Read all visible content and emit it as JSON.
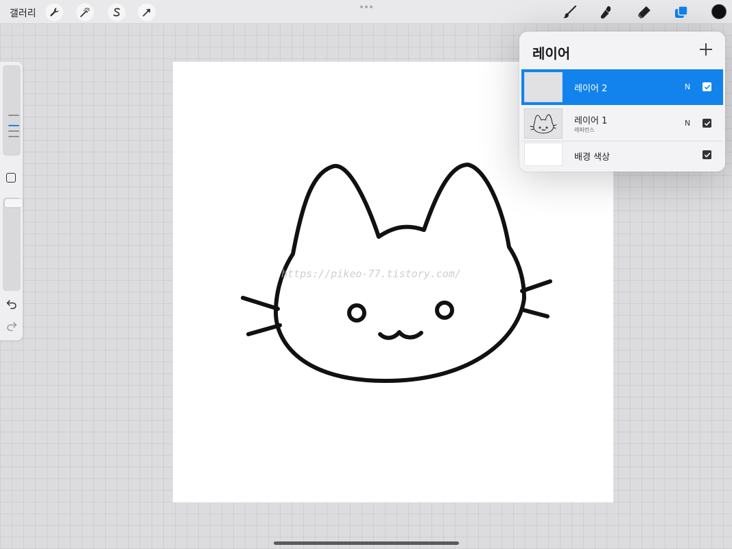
{
  "toolbar": {
    "gallery_label": "갤러리",
    "left_tools": [
      "wrench-icon",
      "magic-wand-icon",
      "selection-s-icon",
      "transform-arrow-icon"
    ],
    "right_tools": [
      "brush-icon",
      "smudge-icon",
      "eraser-icon",
      "layers-icon"
    ],
    "active_tool": "layers-icon",
    "accent_color": "#1283ec",
    "current_color": "#111111"
  },
  "canvas": {
    "watermark": "https://pikeo-77.tistory.com/",
    "background": "#ffffff"
  },
  "layers_panel": {
    "title": "레이어",
    "add_icon": "plus-icon",
    "layers": [
      {
        "name": "레이어 2",
        "sub": "",
        "blend": "N",
        "visible": true,
        "selected": true
      },
      {
        "name": "레이어 1",
        "sub": "레퍼런스",
        "blend": "N",
        "visible": true,
        "selected": false
      },
      {
        "name": "배경 색상",
        "sub": "",
        "blend": "",
        "visible": true,
        "selected": false
      }
    ]
  },
  "sidebar": {
    "undo_icon": "undo-icon",
    "redo_icon": "redo-icon",
    "modify_icon": "square-modify-icon"
  }
}
